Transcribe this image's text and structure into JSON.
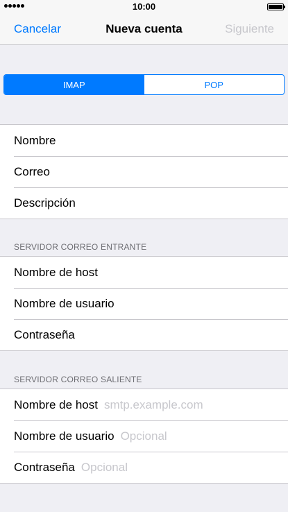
{
  "status_bar": {
    "time": "10:00",
    "battery_level": 1.0
  },
  "nav": {
    "cancel_label": "Cancelar",
    "title": "Nueva cuenta",
    "next_label": "Siguiente"
  },
  "segments": {
    "imap": "IMAP",
    "pop": "POP",
    "selected": "IMAP"
  },
  "account": {
    "name_label": "Nombre",
    "email_label": "Correo",
    "description_label": "Descripción"
  },
  "incoming": {
    "header": "SERVIDOR CORREO ENTRANTE",
    "host_label": "Nombre de host",
    "user_label": "Nombre de usuario",
    "password_label": "Contraseña"
  },
  "outgoing": {
    "header": "SERVIDOR CORREO SALIENTE",
    "host_label": "Nombre de host",
    "host_placeholder": "smtp.example.com",
    "user_label": "Nombre de usuario",
    "user_placeholder": "Opcional",
    "password_label": "Contraseña",
    "password_placeholder": "Opcional"
  },
  "colors": {
    "accent": "#007aff",
    "disabled": "#c7c7cc",
    "background": "#efeff4"
  }
}
